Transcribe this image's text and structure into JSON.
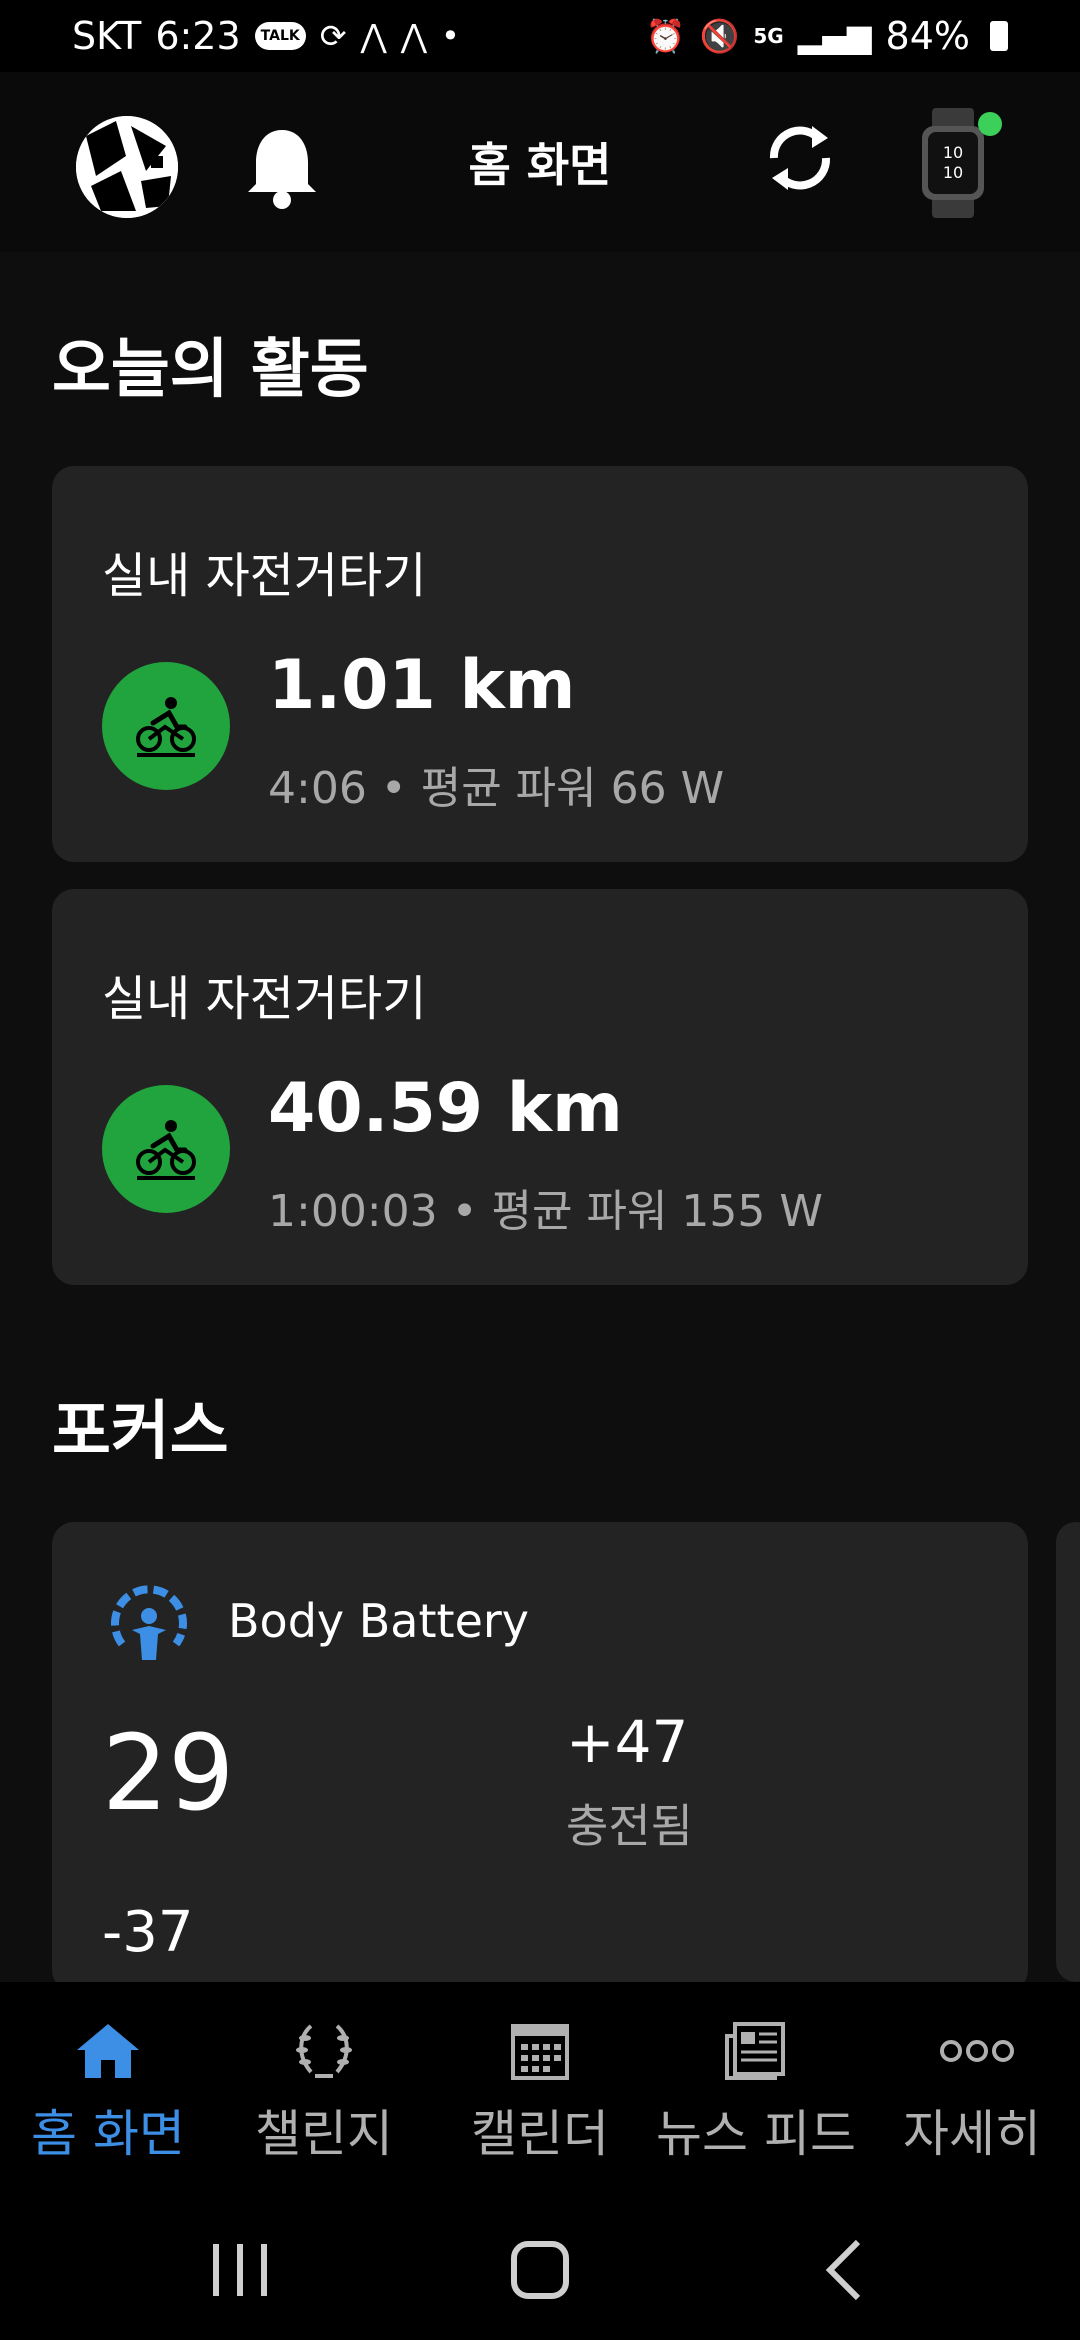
{
  "status_bar": {
    "carrier": "SKT",
    "time": "6:23",
    "talk_badge": "TALK",
    "network": "5G",
    "battery": "84%"
  },
  "header": {
    "title": "홈 화면"
  },
  "today": {
    "section_title": "오늘의 활동",
    "activities": [
      {
        "type": "실내 자전거타기",
        "distance": "1.01 km",
        "details": "4:06 • 평균 파워 66 W",
        "icon": "indoor-cycling-icon",
        "color": "#21a33d"
      },
      {
        "type": "실내 자전거타기",
        "distance": "40.59 km",
        "details": "1:00:03 • 평균 파워 155 W",
        "icon": "indoor-cycling-icon",
        "color": "#21a33d"
      }
    ]
  },
  "focus": {
    "section_title": "포커스",
    "body_battery": {
      "title": "Body Battery",
      "value": "29",
      "charged": "+47",
      "charged_label": "충전됨",
      "drained": "-37",
      "icon_color": "#3d8fe6"
    }
  },
  "bottom_nav": {
    "active_color": "#3d8fe6",
    "items": [
      {
        "label": "홈 화면",
        "icon": "home-icon",
        "active": true
      },
      {
        "label": "챌린지",
        "icon": "laurel-icon",
        "active": false
      },
      {
        "label": "캘린더",
        "icon": "calendar-icon",
        "active": false
      },
      {
        "label": "뉴스 피드",
        "icon": "newsfeed-icon",
        "active": false
      },
      {
        "label": "자세히",
        "icon": "more-icon",
        "active": false
      }
    ]
  }
}
